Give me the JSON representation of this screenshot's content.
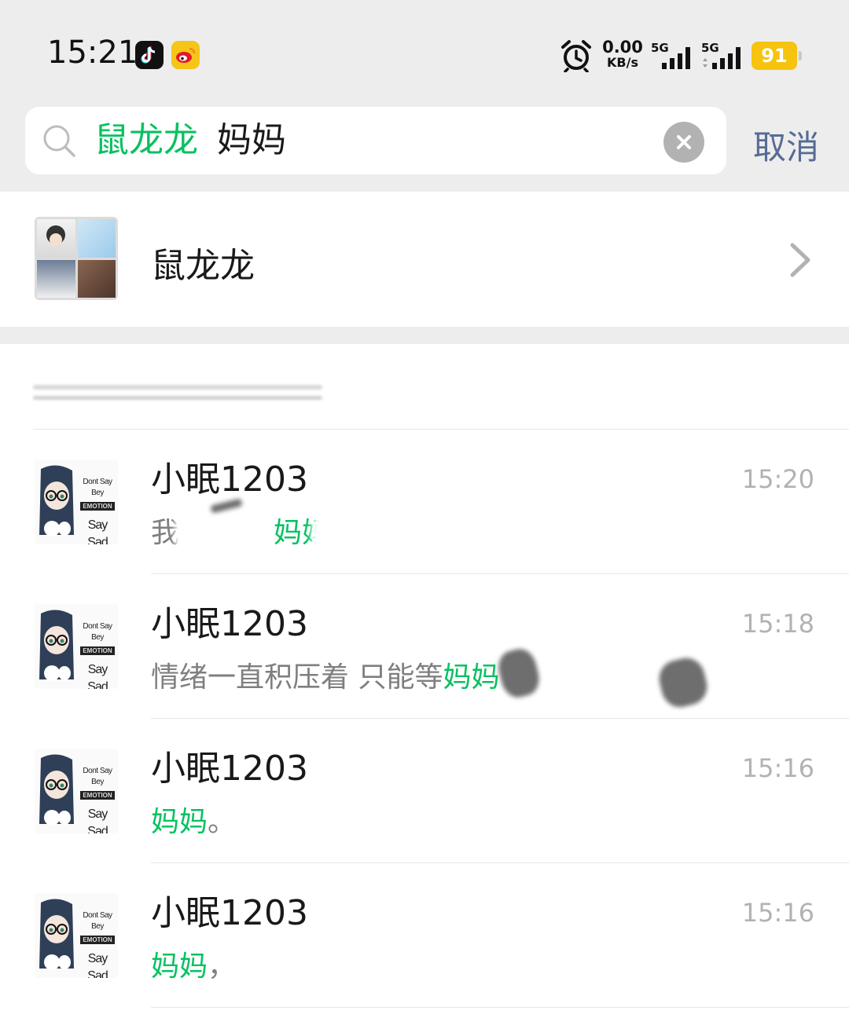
{
  "status_bar": {
    "time": "15:21",
    "net_speed": "0.00",
    "net_unit": "KB/s",
    "sim1": "5G",
    "sim2": "5G",
    "battery": "91",
    "apps": [
      "tiktok-icon",
      "weibo-icon"
    ]
  },
  "search": {
    "group_tag": "鼠龙龙",
    "keyword": "妈妈",
    "cancel_label": "取消"
  },
  "group_result": {
    "name": "鼠龙龙"
  },
  "messages": [
    {
      "sender": "小眠1203",
      "time": "15:20",
      "text_before": "我",
      "highlight": "妈妈",
      "text_after": ""
    },
    {
      "sender": "小眠1203",
      "time": "15:18",
      "text_before": "情绪一直积压着 只能等",
      "highlight": "妈妈",
      "text_after": ""
    },
    {
      "sender": "小眠1203",
      "time": "15:16",
      "text_before": "",
      "highlight": "妈妈",
      "text_after": "。"
    },
    {
      "sender": "小眠1203",
      "time": "15:16",
      "text_before": "",
      "highlight": "妈妈",
      "text_after": "，"
    }
  ],
  "avatar_text": {
    "line1": "Dont Say Bey",
    "line2": "EMOTION",
    "line3": "Say Sad"
  },
  "colors": {
    "highlight": "#07c160",
    "cancel": "#576b95",
    "background_gray": "#ededed",
    "battery": "#f6c30f"
  }
}
